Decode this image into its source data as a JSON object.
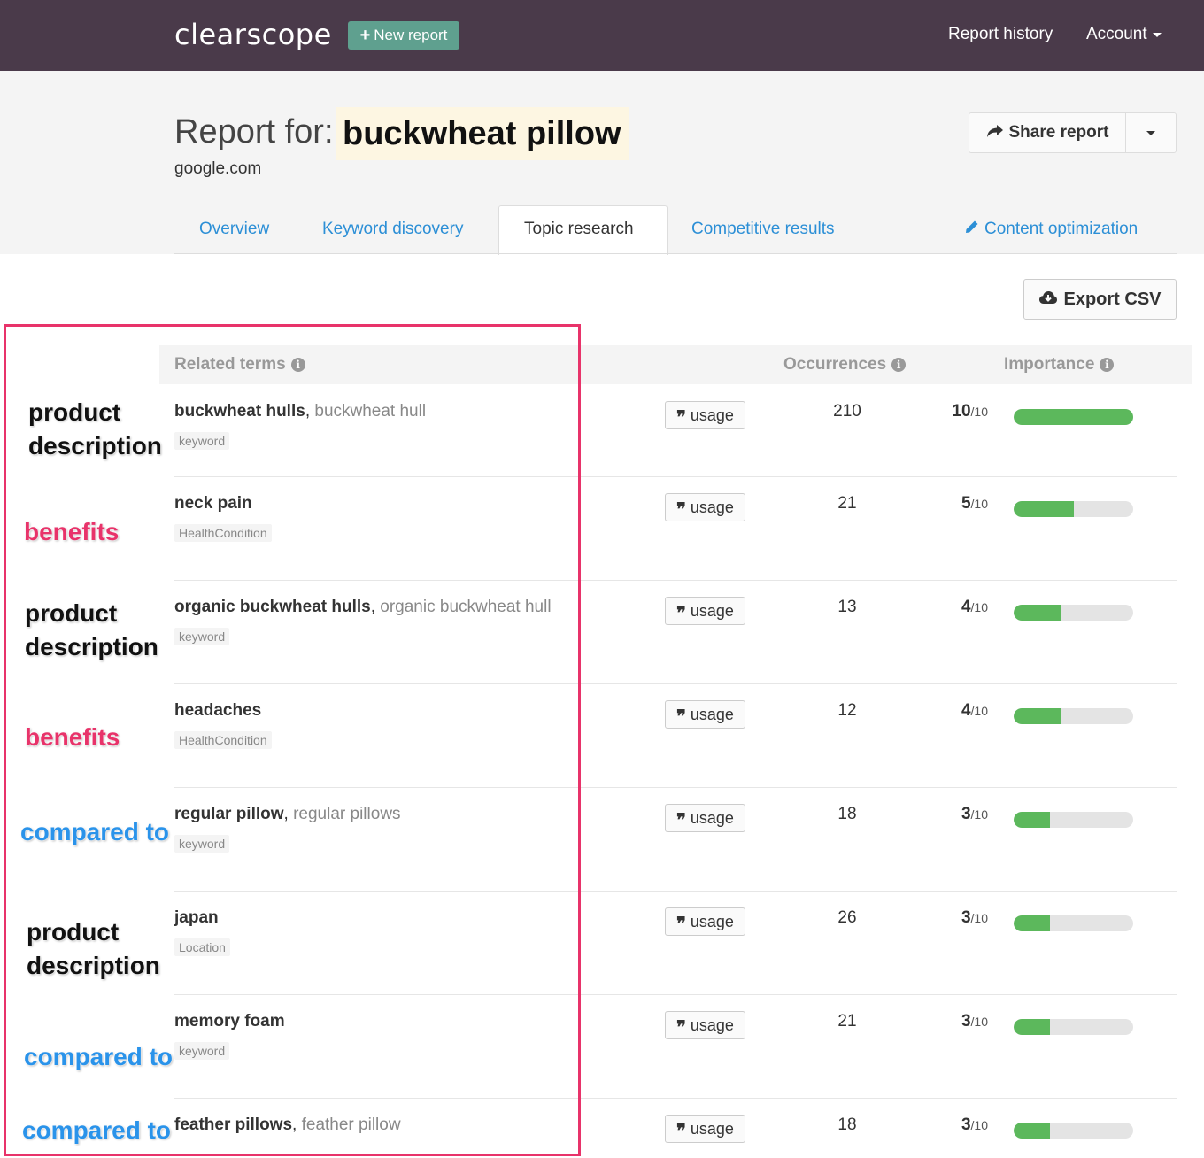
{
  "colors": {
    "nav_bg": "#4a3a4a",
    "new_report_bg": "#5fa08f",
    "tab_link": "#2c8fd6",
    "bar_fill": "#5cb85c",
    "annotation_box": "#e8336a",
    "annotation_benefits": "#e8336a",
    "annotation_compared": "#2a93ea"
  },
  "nav": {
    "logo": "clearscope",
    "new_report_label": "New report",
    "report_history": "Report history",
    "account": "Account"
  },
  "header": {
    "report_for": "Report for:",
    "keyword": "buckwheat pillow",
    "domain": "google.com",
    "share_label": "Share report"
  },
  "tabs": [
    {
      "label": "Overview",
      "active": false
    },
    {
      "label": "Keyword discovery",
      "active": false
    },
    {
      "label": "Topic research",
      "active": true
    },
    {
      "label": "Competitive results",
      "active": false
    },
    {
      "label": "Content optimization",
      "active": false
    }
  ],
  "export_label": "Export CSV",
  "table": {
    "headers": {
      "terms": "Related terms",
      "occurrences": "Occurrences",
      "importance": "Importance"
    },
    "usage_label": "usage",
    "importance_denominator": "/10",
    "rows": [
      {
        "term": "buckwheat hulls",
        "variant": "buckwheat hull",
        "tag": "keyword",
        "occurrences": "210",
        "importance": "10",
        "importance_value": 10
      },
      {
        "term": "neck pain",
        "variant": "",
        "tag": "HealthCondition",
        "occurrences": "21",
        "importance": "5",
        "importance_value": 5
      },
      {
        "term": "organic buckwheat hulls",
        "variant": "organic buckwheat hull",
        "tag": "keyword",
        "occurrences": "13",
        "importance": "4",
        "importance_value": 4
      },
      {
        "term": "headaches",
        "variant": "",
        "tag": "HealthCondition",
        "occurrences": "12",
        "importance": "4",
        "importance_value": 4
      },
      {
        "term": "regular pillow",
        "variant": "regular pillows",
        "tag": "keyword",
        "occurrences": "18",
        "importance": "3",
        "importance_value": 3
      },
      {
        "term": "japan",
        "variant": "",
        "tag": "Location",
        "occurrences": "26",
        "importance": "3",
        "importance_value": 3
      },
      {
        "term": "memory foam",
        "variant": "",
        "tag": "keyword",
        "occurrences": "21",
        "importance": "3",
        "importance_value": 3
      },
      {
        "term": "feather pillows",
        "variant": "feather pillow",
        "tag": "",
        "occurrences": "18",
        "importance": "3",
        "importance_value": 3
      }
    ]
  },
  "annotations": [
    {
      "text": "product\ndescription",
      "kind": "product"
    },
    {
      "text": "benefits",
      "kind": "benefits"
    },
    {
      "text": "product\ndescription",
      "kind": "product"
    },
    {
      "text": "benefits",
      "kind": "benefits"
    },
    {
      "text": "compared to",
      "kind": "compared"
    },
    {
      "text": "product\ndescription",
      "kind": "product"
    },
    {
      "text": "compared to",
      "kind": "compared"
    },
    {
      "text": "compared to",
      "kind": "compared"
    }
  ]
}
